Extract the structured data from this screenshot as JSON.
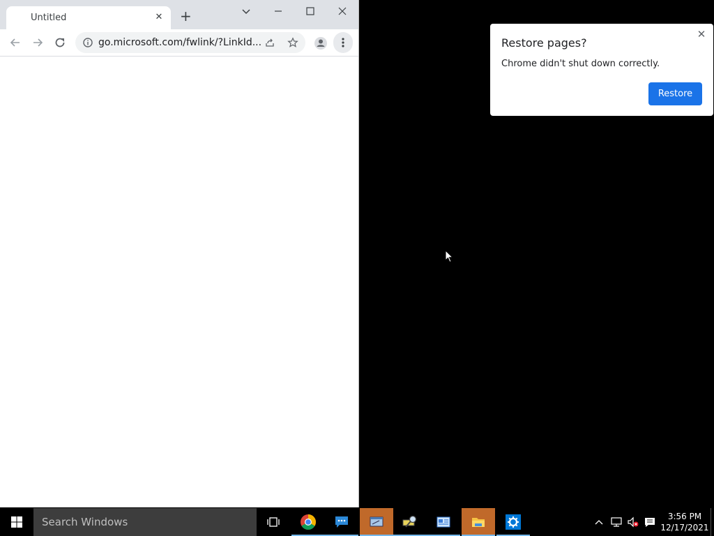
{
  "browser": {
    "tab_title": "Untitled",
    "url": "go.microsoft.com/fwlink/?LinkId..."
  },
  "dialog": {
    "title": "Restore pages?",
    "message": "Chrome didn't shut down correctly.",
    "button_label": "Restore"
  },
  "taskbar": {
    "search_placeholder": "Search Windows",
    "time": "3:56 PM",
    "date": "12/17/2021"
  },
  "colors": {
    "accent": "#1a73e8",
    "taskbar_active": "#76b9ed"
  }
}
